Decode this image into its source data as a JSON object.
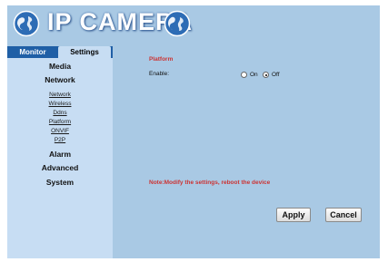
{
  "header": {
    "title": "IP CAMERA"
  },
  "tabs": {
    "monitor": "Monitor",
    "settings": "Settings"
  },
  "menu": {
    "media": "Media",
    "network": "Network",
    "network_items": [
      "Network",
      "Wireless",
      "Ddns",
      "Platform",
      "ONVIF",
      "P2P"
    ],
    "alarm": "Alarm",
    "advanced": "Advanced",
    "system": "System"
  },
  "main": {
    "section_title": "Platform",
    "enable_label": "Enable:",
    "on_label": "On",
    "off_label": "Off",
    "selected": "Off",
    "note": "Note:Modify the settings, reboot the device",
    "apply_label": "Apply",
    "cancel_label": "Cancel"
  },
  "colors": {
    "background": "#a9c9e4",
    "sidebar": "#c7ddf3",
    "tab_bar": "#1f5fa6",
    "accent_red": "#cc3333"
  },
  "icons": {
    "logo_left": "globe-icon",
    "logo_right": "globe-icon"
  }
}
